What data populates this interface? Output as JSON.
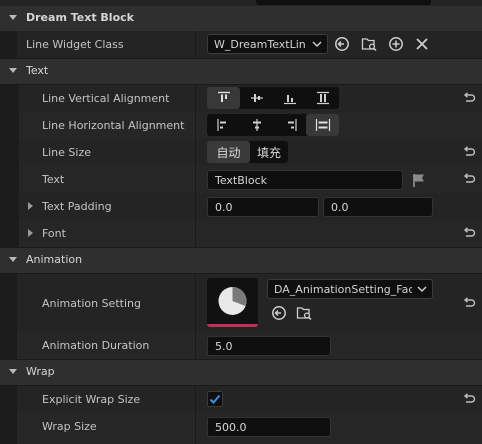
{
  "sections": {
    "dream_text_block": "Dream Text Block",
    "text": "Text",
    "animation": "Animation",
    "wrap": "Wrap"
  },
  "props": {
    "line_widget_class": {
      "label": "Line Widget Class",
      "value": "W_DreamTextLine"
    },
    "line_vertical_alignment": {
      "label": "Line Vertical Alignment"
    },
    "line_horizontal_alignment": {
      "label": "Line Horizontal Alignment"
    },
    "line_size": {
      "label": "Line Size",
      "options": [
        "自动",
        "填充"
      ],
      "selected": "自动"
    },
    "text": {
      "label": "Text",
      "value": "TextBlock"
    },
    "text_padding": {
      "label": "Text Padding",
      "x": "0.0",
      "y": "0.0"
    },
    "font": {
      "label": "Font"
    },
    "animation_setting": {
      "label": "Animation Setting",
      "value": "DA_AnimationSetting_Fade"
    },
    "animation_duration": {
      "label": "Animation Duration",
      "value": "5.0"
    },
    "explicit_wrap_size": {
      "label": "Explicit Wrap Size",
      "checked": true
    },
    "wrap_size": {
      "label": "Wrap Size",
      "value": "500.0"
    }
  },
  "colors": {
    "accent_pink": "#c0305a",
    "check_blue": "#3a8ee6",
    "panel": "#242424",
    "category": "#2f2f2f"
  },
  "icons": [
    "browse-icon",
    "use-selected-icon",
    "add-icon",
    "clear-icon",
    "reset-icon",
    "flag-icon"
  ]
}
